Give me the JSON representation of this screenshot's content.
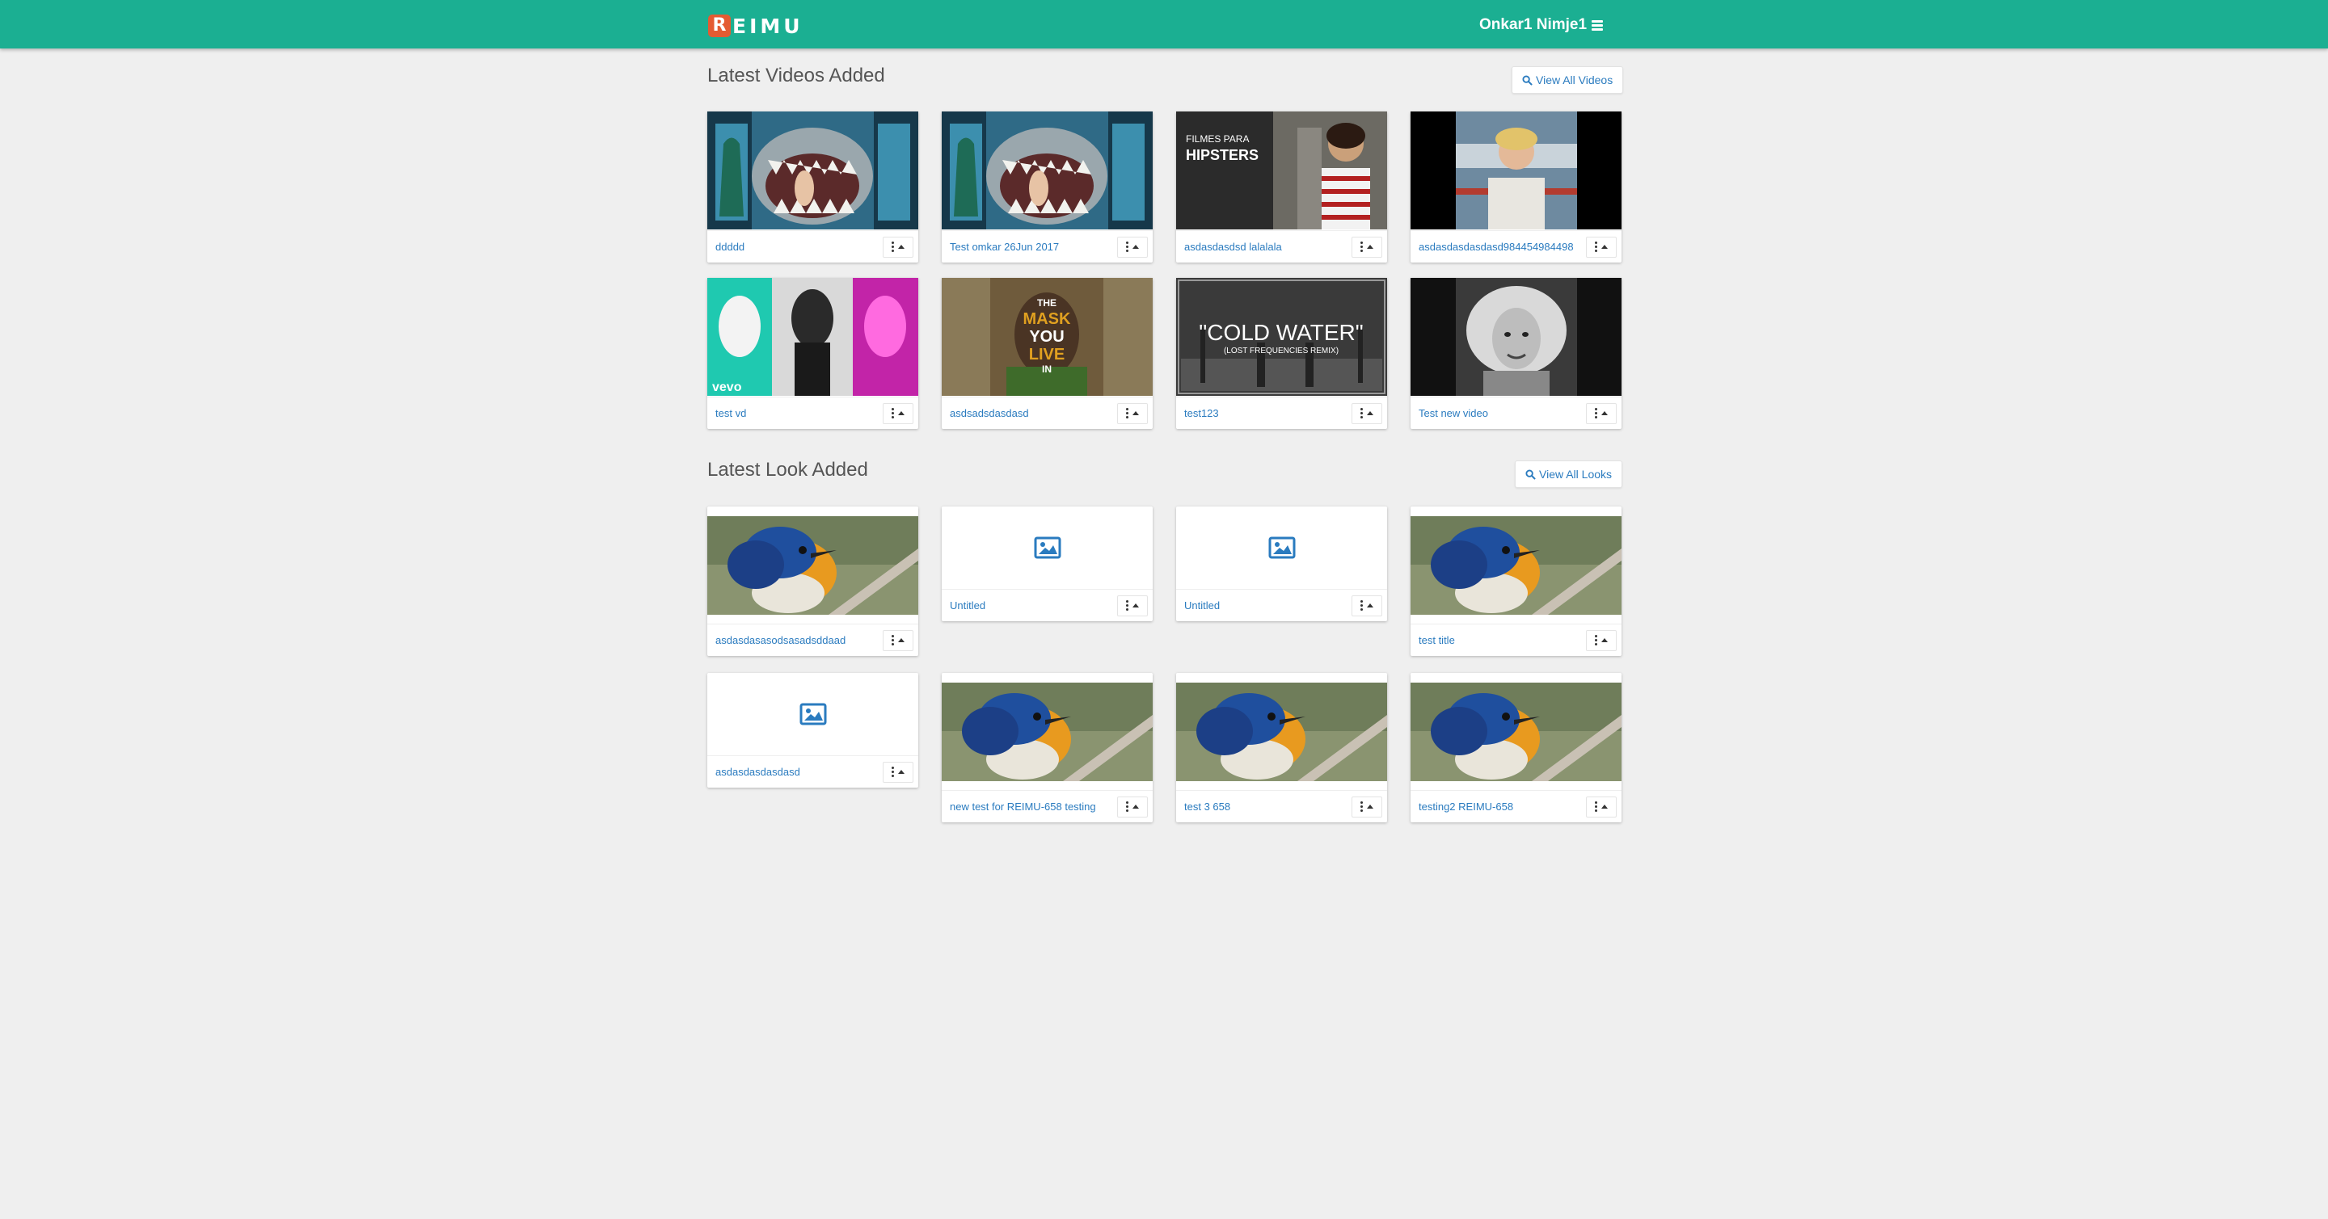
{
  "header": {
    "logo_letter": "R",
    "logo_text": "EIMU",
    "user_name": "Onkar1 Nimje1"
  },
  "videos_section": {
    "title": "Latest Videos Added",
    "view_all_label": "View All Videos",
    "items": [
      {
        "title": "ddddd",
        "thumb": "shark-mouth"
      },
      {
        "title": "Test omkar 26Jun 2017",
        "thumb": "shark-mouth"
      },
      {
        "title": "asdasdasdsd lalalala",
        "thumb": "filmes-para-hipsters",
        "thumb_text_1": "FILMES PARA",
        "thumb_text_2": "HIPSTERS"
      },
      {
        "title": "asdasdasdasdasd984454984498",
        "thumb": "boy-blonde"
      },
      {
        "title": "test vd",
        "thumb": "vevo-pop",
        "thumb_text": "vevo"
      },
      {
        "title": "asdsadsdasdasd",
        "thumb": "mask-you-live-in",
        "thumb_text_1": "THE",
        "thumb_text_2": "MASK",
        "thumb_text_3": "YOU",
        "thumb_text_4": "LIVE",
        "thumb_text_5": "IN"
      },
      {
        "title": "test123",
        "thumb": "cold-water",
        "thumb_text_1": "\"COLD WATER\"",
        "thumb_text_2": "(LOST FREQUENCIES REMIX)"
      },
      {
        "title": "Test new video",
        "thumb": "bw-portrait"
      }
    ]
  },
  "looks_section": {
    "title": "Latest Look Added",
    "view_all_label": "View All Looks",
    "items": [
      {
        "title": "asdasdasasodsasadsddaad",
        "thumb": "bird"
      },
      {
        "title": "Untitled",
        "thumb": "placeholder"
      },
      {
        "title": "Untitled",
        "thumb": "placeholder"
      },
      {
        "title": "test title",
        "thumb": "bird"
      },
      {
        "title": "asdasdasdasdasd",
        "thumb": "placeholder"
      },
      {
        "title": "new test for REIMU-658 testing",
        "thumb": "bird"
      },
      {
        "title": "test 3 658",
        "thumb": "bird"
      },
      {
        "title": "testing2 REIMU-658",
        "thumb": "bird"
      }
    ]
  },
  "colors": {
    "header_bg": "#1baf92",
    "link": "#2a7bbf",
    "logo_accent": "#e45b32",
    "page_bg": "#efefef"
  }
}
